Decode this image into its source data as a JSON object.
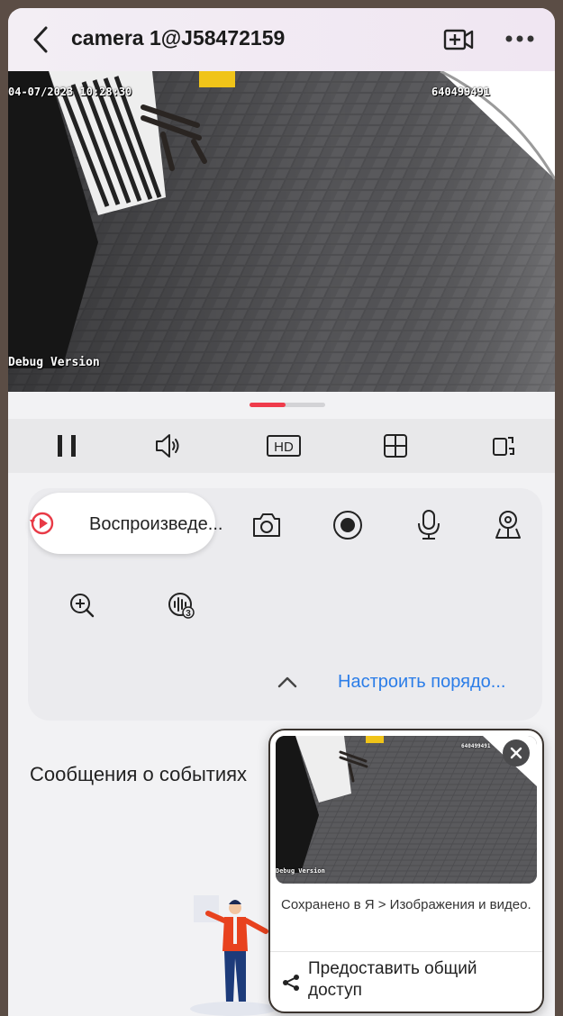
{
  "header": {
    "title": "camera 1@J58472159",
    "back_icon": "chevron-left-icon",
    "record_icon": "video-plus-icon",
    "more_icon": "more-dots-icon"
  },
  "video": {
    "timestamp": "04-07/2023 10:28:30",
    "device_code": "640499491",
    "debug_label": "Debug Version"
  },
  "controls": [
    {
      "name": "pause-button",
      "icon": "pause-icon"
    },
    {
      "name": "volume-button",
      "icon": "speaker-icon"
    },
    {
      "name": "hd-button",
      "icon": "hd-icon",
      "label": "HD"
    },
    {
      "name": "multiview-button",
      "icon": "grid-icon"
    },
    {
      "name": "rotate-button",
      "icon": "rotate-screen-icon"
    }
  ],
  "tools": {
    "playback_label": "Воспроизведе...",
    "arrange_label": "Настроить порядо..."
  },
  "events": {
    "title": "Сообщения о событиях"
  },
  "toast": {
    "message": "Сохранено в Я > Изображения и видео.",
    "share_label": "Предоставить общий доступ"
  },
  "colors": {
    "accent_red": "#ef3b4b",
    "link_blue": "#2b7de8"
  }
}
